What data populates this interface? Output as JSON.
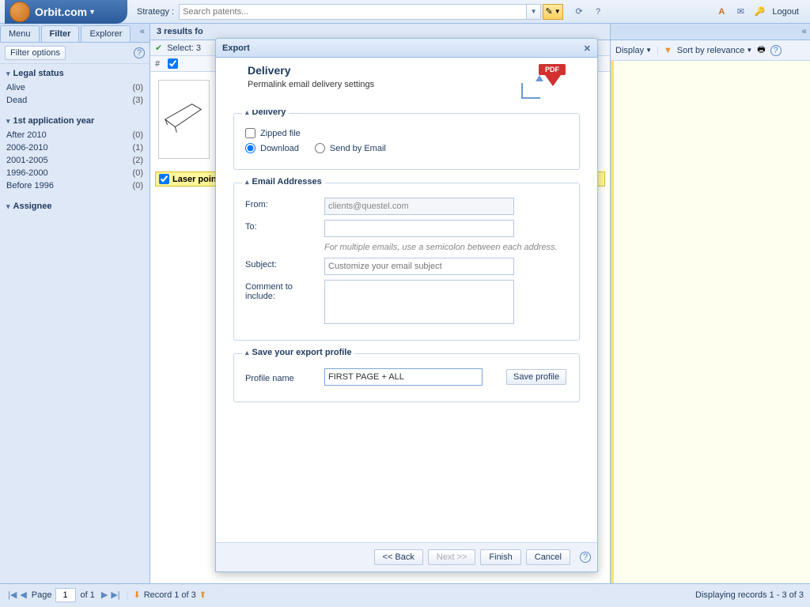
{
  "topbar": {
    "logo_text": "Orbit.com",
    "strategy_label": "Strategy :",
    "search_placeholder": "Search patents...",
    "logout": "Logout"
  },
  "sidebar": {
    "tabs": {
      "menu": "Menu",
      "filter": "Filter",
      "explorer": "Explorer"
    },
    "filter_options": "Filter options",
    "groups": [
      {
        "title": "Legal status",
        "items": [
          {
            "label": "Alive",
            "count": "(0)"
          },
          {
            "label": "Dead",
            "count": "(3)"
          }
        ]
      },
      {
        "title": "1st application year",
        "items": [
          {
            "label": "After 2010",
            "count": "(0)"
          },
          {
            "label": "2006-2010",
            "count": "(1)"
          },
          {
            "label": "2001-2005",
            "count": "(2)"
          },
          {
            "label": "1996-2000",
            "count": "(0)"
          },
          {
            "label": "Before 1996",
            "count": "(0)"
          }
        ]
      },
      {
        "title": "Assignee",
        "items": []
      }
    ]
  },
  "center": {
    "header": "3 results fo",
    "select_label": "Select: 3",
    "hash_col": "#",
    "highlighted": "Laser poin"
  },
  "right": {
    "display": "Display",
    "sort": "Sort by relevance"
  },
  "footer": {
    "page_label": "Page",
    "page_value": "1",
    "of_label": "of 1",
    "record_label": "Record 1 of 3",
    "displaying": "Displaying records 1 - 3 of 3"
  },
  "modal": {
    "title": "Export",
    "heading": "Delivery",
    "subheading": "Permalink email delivery settings",
    "pdf_label": "PDF",
    "delivery": {
      "legend": "Delivery",
      "zipped": "Zipped file",
      "download": "Download",
      "send_email": "Send by Email"
    },
    "email": {
      "legend": "Email Addresses",
      "from_label": "From:",
      "from_value": "clients@questel.com",
      "to_label": "To:",
      "hint": "For multiple emails, use a semicolon between each address.",
      "subject_label": "Subject:",
      "subject_placeholder": "Customize your email subject",
      "comment_label": "Comment to include:"
    },
    "profile": {
      "legend": "Save your export profile",
      "name_label": "Profile name",
      "name_value": "FIRST PAGE + ALL",
      "save_btn": "Save profile"
    },
    "buttons": {
      "back": "<< Back",
      "next": "Next >>",
      "finish": "Finish",
      "cancel": "Cancel"
    }
  }
}
